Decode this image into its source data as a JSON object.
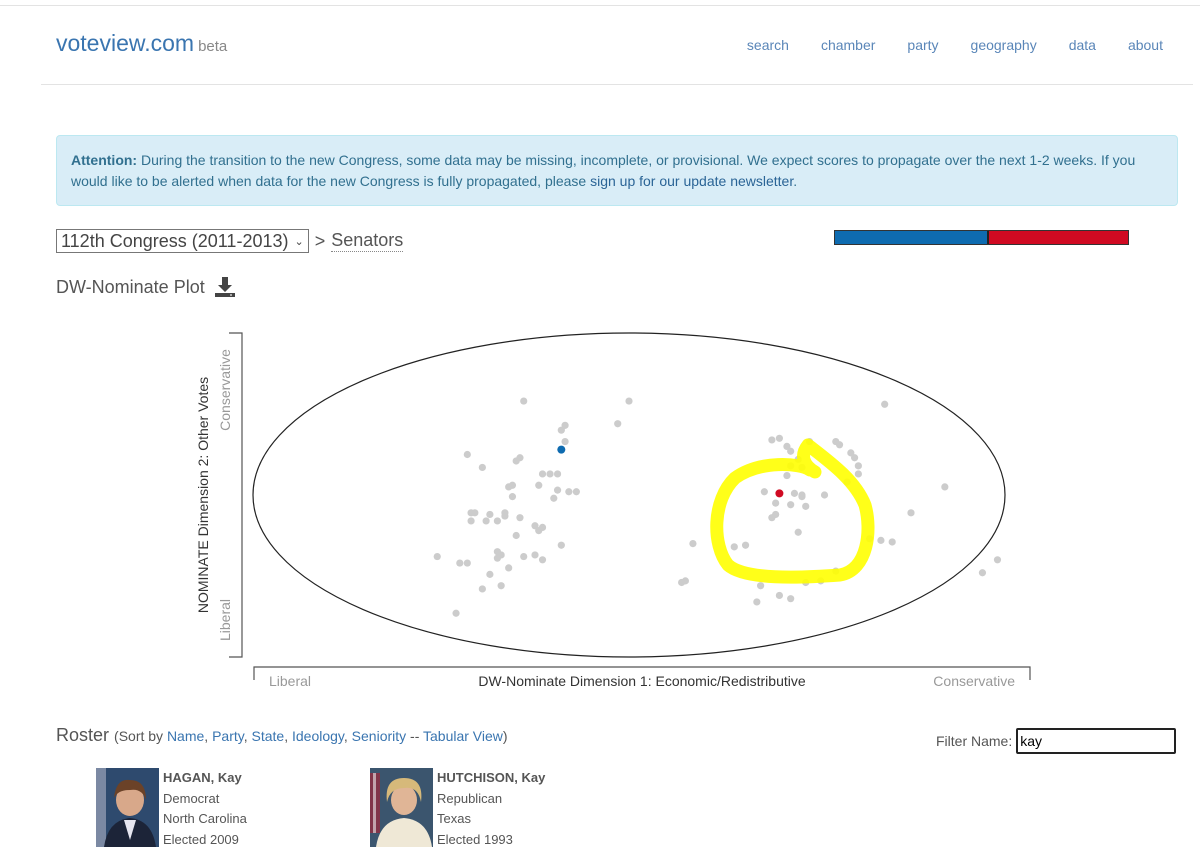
{
  "header": {
    "brand": "voteview.com",
    "brand_suffix": "beta",
    "nav": [
      "search",
      "chamber",
      "party",
      "geography",
      "data",
      "about"
    ]
  },
  "alert": {
    "label": "Attention:",
    "text": " During the transition to the new Congress, some data may be missing, incomplete, or provisional. We expect scores to propagate over the next 1-2 weeks. If you would like to be alerted when data for the new Congress is fully propagated, please ",
    "link": "sign up for our update newsletter",
    "end": "."
  },
  "selector": {
    "congress": "112th Congress (2011-2013)",
    "separator": ">",
    "chamber": "Senators"
  },
  "party_bar": {
    "dem_share": 0.52,
    "colors": {
      "dem": "#0e6bb0",
      "rep": "#d00a22"
    }
  },
  "plot_title": "DW-Nominate Plot",
  "icons": {
    "download": "download-icon"
  },
  "chart_data": {
    "type": "scatter",
    "title": "DW-Nominate Plot",
    "xlabel": "DW-Nominate Dimension 1: Economic/Redistributive",
    "ylabel": "NOMINATE Dimension 2: Other Votes",
    "x_ticks": {
      "left": "Liberal",
      "right": "Conservative"
    },
    "y_ticks": {
      "bottom": "Liberal",
      "top": "Conservative"
    },
    "xlim": [
      -1,
      1
    ],
    "ylim": [
      -1,
      1
    ],
    "boundary": "unit-ellipse",
    "colors": {
      "other": "#cccccc",
      "dem": "#0e6bb0",
      "rep": "#d00a22",
      "annotation": "#ffff00"
    },
    "highlighted": [
      {
        "name": "HAGAN, Kay",
        "party": "Democrat",
        "x": -0.18,
        "y": 0.28
      },
      {
        "name": "HUTCHISON, Kay",
        "party": "Republican",
        "x": 0.4,
        "y": 0.01
      }
    ],
    "points": [
      [
        -0.28,
        0.58
      ],
      [
        -0.17,
        0.43
      ],
      [
        -0.18,
        0.4
      ],
      [
        -0.17,
        0.33
      ],
      [
        0.0,
        0.58
      ],
      [
        -0.03,
        0.44
      ],
      [
        -0.43,
        0.25
      ],
      [
        -0.39,
        0.17
      ],
      [
        -0.3,
        0.21
      ],
      [
        -0.29,
        0.23
      ],
      [
        -0.23,
        0.13
      ],
      [
        -0.21,
        0.13
      ],
      [
        -0.19,
        0.13
      ],
      [
        -0.32,
        0.05
      ],
      [
        -0.31,
        0.06
      ],
      [
        -0.24,
        0.06
      ],
      [
        -0.19,
        0.03
      ],
      [
        -0.16,
        0.02
      ],
      [
        -0.14,
        0.02
      ],
      [
        -0.2,
        -0.02
      ],
      [
        -0.31,
        -0.01
      ],
      [
        -0.42,
        -0.11
      ],
      [
        -0.41,
        -0.11
      ],
      [
        -0.37,
        -0.12
      ],
      [
        -0.33,
        -0.11
      ],
      [
        -0.33,
        -0.13
      ],
      [
        -0.42,
        -0.16
      ],
      [
        -0.38,
        -0.16
      ],
      [
        -0.35,
        -0.16
      ],
      [
        -0.29,
        -0.14
      ],
      [
        -0.25,
        -0.19
      ],
      [
        -0.24,
        -0.22
      ],
      [
        -0.23,
        -0.2
      ],
      [
        -0.3,
        -0.25
      ],
      [
        -0.18,
        -0.31
      ],
      [
        -0.35,
        -0.35
      ],
      [
        -0.34,
        -0.37
      ],
      [
        -0.35,
        -0.39
      ],
      [
        -0.28,
        -0.38
      ],
      [
        -0.25,
        -0.37
      ],
      [
        -0.23,
        -0.4
      ],
      [
        -0.51,
        -0.38
      ],
      [
        -0.45,
        -0.42
      ],
      [
        -0.43,
        -0.42
      ],
      [
        -0.32,
        -0.45
      ],
      [
        -0.37,
        -0.49
      ],
      [
        -0.34,
        -0.56
      ],
      [
        -0.39,
        -0.58
      ],
      [
        -0.46,
        -0.73
      ],
      [
        0.17,
        -0.3
      ],
      [
        0.14,
        -0.54
      ],
      [
        0.15,
        -0.53
      ],
      [
        0.34,
        -0.66
      ],
      [
        0.4,
        -0.62
      ],
      [
        0.43,
        -0.64
      ],
      [
        0.35,
        -0.56
      ],
      [
        0.47,
        -0.54
      ],
      [
        0.51,
        -0.53
      ],
      [
        0.55,
        -0.47
      ],
      [
        0.28,
        -0.32
      ],
      [
        0.31,
        -0.31
      ],
      [
        0.45,
        -0.23
      ],
      [
        0.39,
        -0.12
      ],
      [
        0.38,
        -0.14
      ],
      [
        0.47,
        -0.07
      ],
      [
        0.43,
        -0.06
      ],
      [
        0.44,
        0.01
      ],
      [
        0.46,
        0.0
      ],
      [
        0.46,
        -0.01
      ],
      [
        0.39,
        -0.05
      ],
      [
        0.52,
        0.0
      ],
      [
        0.36,
        0.02
      ],
      [
        0.48,
        0.33
      ],
      [
        0.38,
        0.34
      ],
      [
        0.4,
        0.35
      ],
      [
        0.42,
        0.3
      ],
      [
        0.43,
        0.27
      ],
      [
        0.45,
        0.22
      ],
      [
        0.46,
        0.17
      ],
      [
        0.43,
        0.18
      ],
      [
        0.42,
        0.12
      ],
      [
        0.55,
        0.33
      ],
      [
        0.56,
        0.31
      ],
      [
        0.59,
        0.26
      ],
      [
        0.6,
        0.23
      ],
      [
        0.61,
        0.18
      ],
      [
        0.61,
        0.13
      ],
      [
        0.58,
        0.08
      ],
      [
        0.64,
        -0.27
      ],
      [
        0.67,
        -0.28
      ],
      [
        0.7,
        -0.29
      ],
      [
        0.68,
        0.56
      ],
      [
        0.75,
        -0.11
      ],
      [
        0.84,
        0.05
      ],
      [
        0.94,
        -0.48
      ],
      [
        0.98,
        -0.4
      ]
    ]
  },
  "roster": {
    "title": "Roster",
    "sort_prefix": "(Sort by ",
    "sort_links": [
      "Name",
      "Party",
      "State",
      "Ideology",
      "Seniority"
    ],
    "sort_sep": " -- ",
    "tabular_link": "Tabular View",
    "sort_suffix": ")",
    "filter_label": "Filter Name:",
    "filter_value": "kay",
    "members": [
      {
        "name": "HAGAN, Kay",
        "party": "Democrat",
        "state": "North Carolina",
        "elected": "Elected 2009"
      },
      {
        "name": "HUTCHISON, Kay",
        "party": "Republican",
        "state": "Texas",
        "elected": "Elected 1993"
      }
    ]
  }
}
